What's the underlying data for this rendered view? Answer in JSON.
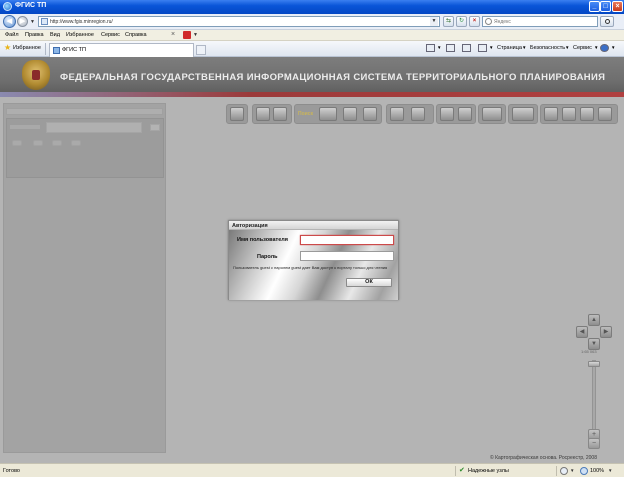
{
  "window": {
    "title": "ФГИС ТП"
  },
  "address_bar": {
    "url": "http://www.fgis.minregion.ru/",
    "search_placeholder": "Яндекс"
  },
  "menu": {
    "items": [
      "Файл",
      "Правка",
      "Вид",
      "Избранное",
      "Сервис",
      "Справка"
    ]
  },
  "favorites_bar": {
    "favorites_label": "Избранное",
    "tab_label": "ФГИС ТП",
    "commands": {
      "page": "Страница",
      "security": "Безопасность",
      "tools": "Сервис"
    }
  },
  "page": {
    "banner_title": "ФЕДЕРАЛЬНАЯ ГОСУДАРСТВЕННАЯ ИНФОРМАЦИОННАЯ СИСТЕМА ТЕРРИТОРИАЛЬНОГО ПЛАНИРОВАНИЯ",
    "toolbar_label": "Поиск",
    "zoom_scale_label": "1:65 063",
    "copyright": "© Картографическая основа. Росреестр, 2008"
  },
  "login_dialog": {
    "title": "Авторизация",
    "username_label": "Имя пользователя",
    "password_label": "Пароль",
    "username_value": "",
    "password_value": "",
    "hint": "Пользователь guest с паролем guest дает Вам доступ к порталу только для чтения",
    "ok_label": "ОК"
  },
  "status_bar": {
    "status": "Готово",
    "zone": "Надежные узлы",
    "zoom": "100%"
  }
}
